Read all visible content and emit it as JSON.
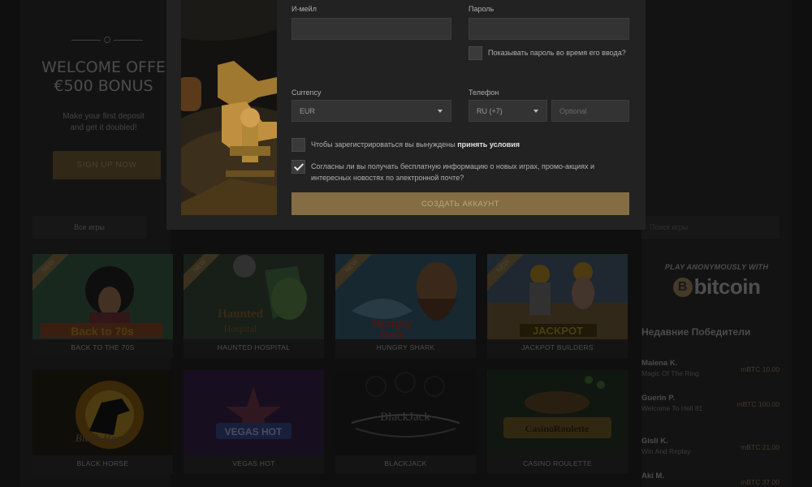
{
  "promo": {
    "welcome_line1": "WELCOME OFFE",
    "welcome_line2": "€500 BONUS",
    "subtext_line1": "Make your first deposit",
    "subtext_line2": "and get it doubled!",
    "signup_label": "SIGN UP NOW"
  },
  "filters": {
    "all_games_label": "Все игры",
    "search_placeholder": "Поиск игры"
  },
  "games": [
    {
      "name": "BACK TO THE 70S",
      "badge": "NEW"
    },
    {
      "name": "HAUNTED HOSPITAL",
      "badge": "NEW"
    },
    {
      "name": "HUNGRY SHARK",
      "badge": "NEW"
    },
    {
      "name": "JACKPOT BUILDERS",
      "badge": "NEW"
    },
    {
      "name": "BLACK HORSE",
      "badge": ""
    },
    {
      "name": "VEGAS HOT",
      "badge": ""
    },
    {
      "name": "BLACKJACK",
      "badge": ""
    },
    {
      "name": "CASINO ROULETTE",
      "badge": ""
    }
  ],
  "bitcoin": {
    "tagline": "PLAY ANONYMOUSLY WITH",
    "coin_symbol": "B",
    "word": "bitcoin"
  },
  "winners": {
    "title": "Недавние Победители",
    "items": [
      {
        "name": "Malena K.",
        "game": "Magic Of The Ring",
        "amount": "mBTC 10.00"
      },
      {
        "name": "Guerin P.",
        "game": "Welcome To Hell 81",
        "amount": "mBTC 100.00"
      },
      {
        "name": "Gisli K.",
        "game": "Win And Replay",
        "amount": "mBTC 21.00"
      },
      {
        "name": "Aki M.",
        "game": "",
        "amount": "mBTC 37.00"
      }
    ]
  },
  "form": {
    "email_label": "И-мейл",
    "email_value": "",
    "password_label": "Пароль",
    "password_value": "",
    "show_password_label": "Показывать пароль во время его ввода?",
    "show_password_checked": false,
    "currency_label": "Currency",
    "currency_value": "EUR",
    "phone_label": "Телефон",
    "phone_code": "RU (+7)",
    "phone_placeholder": "Optional",
    "terms_text": "Чтобы зарегистрироваться вы вынуждены ",
    "terms_link": "принять условия",
    "terms_checked": false,
    "newsletter_text": "Согласны ли вы получать бесплатную информацию о новых играх, промо-акциях и интересных новостях по электронной почте?",
    "newsletter_checked": true,
    "submit_label": "СОЗДАТЬ АККАУНТ"
  },
  "colors": {
    "accent_gold": "#846d44",
    "modal_bg": "#222222"
  }
}
